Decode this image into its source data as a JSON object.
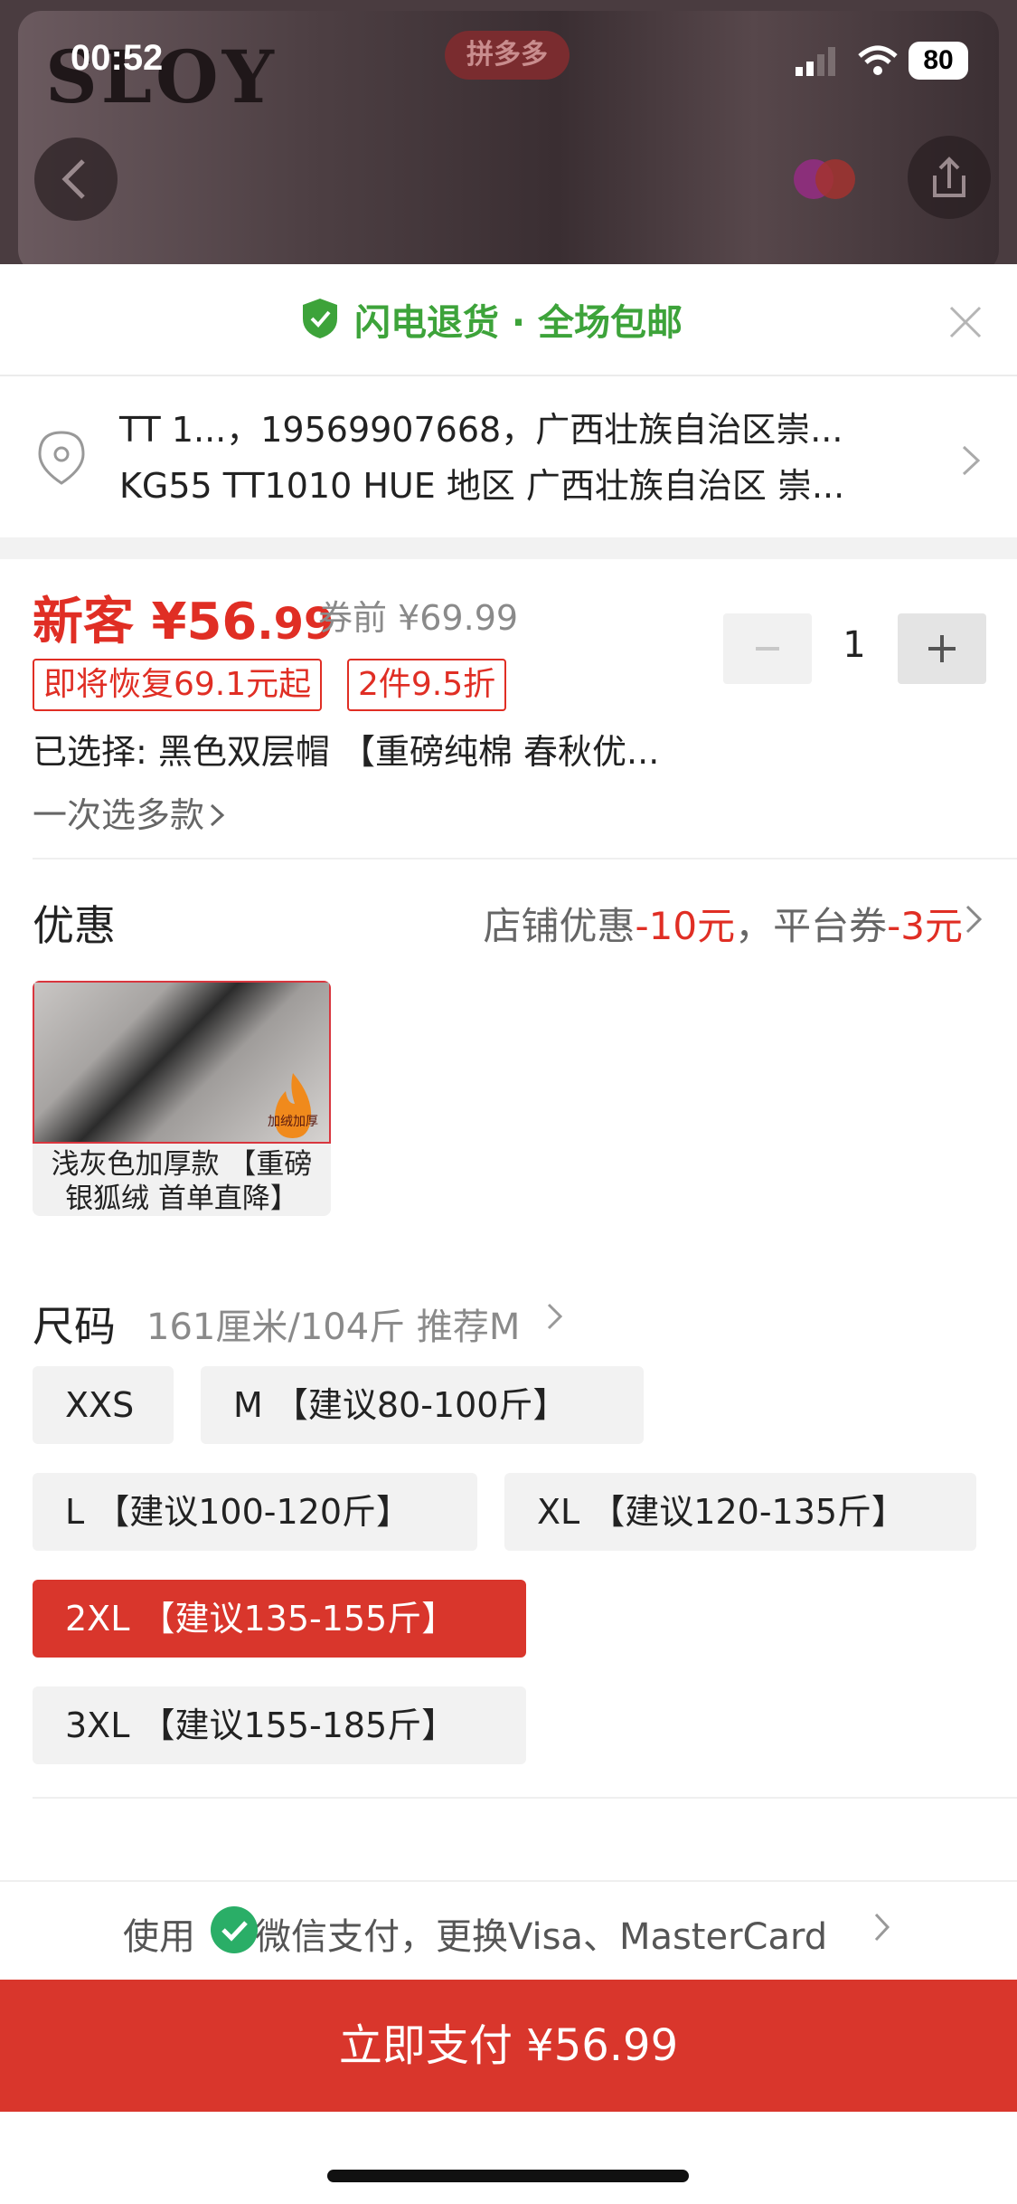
{
  "status_bar": {
    "time": "00:52",
    "battery": "80"
  },
  "top_image": {
    "brand_text": "SLOY",
    "badge": "拼多多"
  },
  "banner": {
    "text": "闪电退货 · 全场包邮"
  },
  "address": {
    "line1": "TT 1...，19569907668，广西壮族自治区崇...",
    "line2": "KG55 TT1010 HUE 地区 广西壮族自治区 崇..."
  },
  "price": {
    "prefix": "新客 ¥56",
    "decimal": ".99",
    "original": "券前 ¥69.99",
    "tags": [
      "即将恢复69.1元起",
      "2件9.5折"
    ],
    "selected": "已选择: 黑色双层帽 【重磅纯棉 春秋优...",
    "multi_select": "一次选多款"
  },
  "quantity": {
    "minus": "−",
    "value": "1",
    "plus": "+"
  },
  "promotion": {
    "label": "优惠",
    "store_text": "店铺优惠",
    "store_amount": "-10元",
    "separator": "，平台券",
    "platform_amount": "-3元"
  },
  "variant": {
    "caption_line1": "浅灰色加厚款 【重磅",
    "caption_line2": "银狐绒 首单直降】",
    "image_badge": "加绒加厚"
  },
  "size": {
    "label": "尺码",
    "recommendation": "161厘米/104斤 推荐M",
    "options": [
      {
        "label": "XXS",
        "selected": false
      },
      {
        "label": "M 【建议80-100斤】",
        "selected": false
      },
      {
        "label": "L 【建议100-120斤】",
        "selected": false
      },
      {
        "label": "XL 【建议120-135斤】",
        "selected": false
      },
      {
        "label": "2XL 【建议135-155斤】",
        "selected": true
      },
      {
        "label": "3XL 【建议155-185斤】",
        "selected": false
      }
    ]
  },
  "payment": {
    "prefix": "使用",
    "method": "微信支付，更换Visa、MasterCard",
    "button": "立即支付 ¥56.99"
  },
  "colors": {
    "accent_red": "#e02e24",
    "button_red": "#d9362c",
    "green": "#3da33a"
  }
}
